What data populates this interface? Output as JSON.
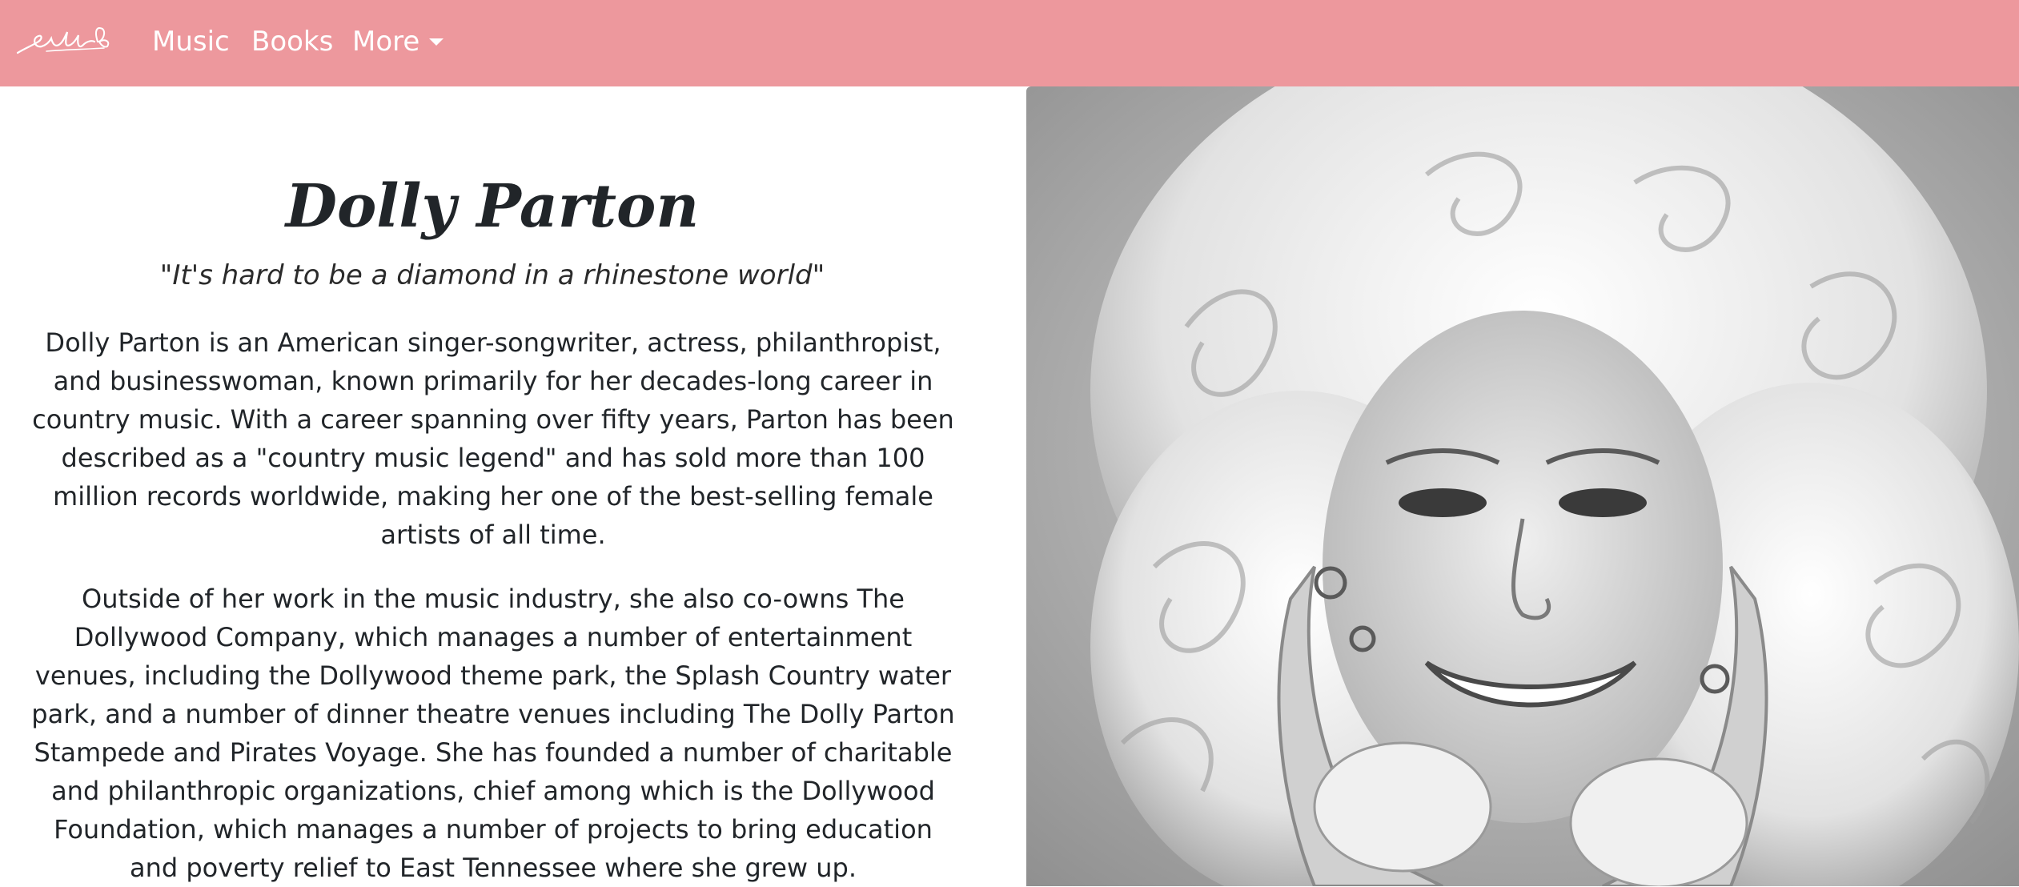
{
  "navbar": {
    "brand_icon": "dolly-signature-butterfly-logo",
    "links": [
      {
        "label": "Music"
      },
      {
        "label": "Books"
      },
      {
        "label": "More"
      }
    ],
    "background_color": "#ed989d"
  },
  "hero": {
    "name": "Dolly Parton",
    "quote": "\"It's hard to be a diamond in a rhinestone world\"",
    "paragraphs": [
      "Dolly Parton is an American singer-songwriter, actress, philanthropist, and businesswoman, known primarily for her decades-long career in country music. With a career spanning over fifty years, Parton has been described as a \"country music legend\" and has sold more than 100 million records worldwide, making her one of the best-selling female artists of all time.",
      "Outside of her work in the music industry, she also co-owns The Dollywood Company, which manages a number of entertainment venues, including the Dollywood theme park, the Splash Country water park, and a number of dinner theatre venues including The Dolly Parton Stampede and Pirates Voyage. She has founded a number of charitable and philanthropic organizations, chief among which is the Dollywood Foundation, which manages a number of projects to bring education and poverty relief to East Tennessee where she grew up."
    ],
    "photo_icon": "portrait-photo"
  }
}
